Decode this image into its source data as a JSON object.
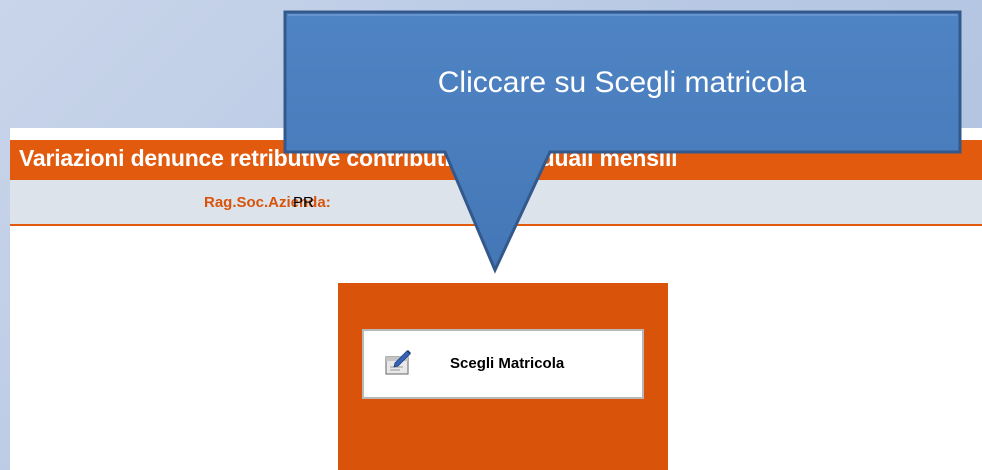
{
  "header": {
    "title": "Variazioni denunce retributive contributive individuali mensili"
  },
  "company": {
    "label": "Rag.Soc.Azienda:",
    "value": "PR"
  },
  "actions": {
    "choose_label": "Scegli Matricola",
    "choose_icon": "edit-icon"
  },
  "callout": {
    "text": "Cliccare su Scegli matricola"
  },
  "colors": {
    "accent": "#e15a0d",
    "panel": "#d9540a",
    "info_bar": "#dde3ea",
    "callout_fill": "#4a7ebb",
    "background": "#bccbe6"
  }
}
